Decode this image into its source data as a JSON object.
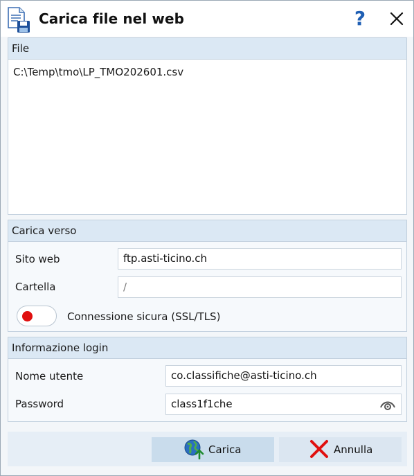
{
  "window": {
    "title": "Carica file nel web",
    "help_label": "?"
  },
  "file_group": {
    "header": "File",
    "items": [
      "C:\\Temp\\tmo\\LP_TMO202601.csv"
    ]
  },
  "upload_group": {
    "header": "Carica verso",
    "site_label": "Sito web",
    "site_value": "ftp.asti-ticino.ch",
    "folder_label": "Cartella",
    "folder_value": "/",
    "secure_label": "Connessione sicura (SSL/TLS)",
    "secure_enabled": false
  },
  "login_group": {
    "header": "Informazione login",
    "user_label": "Nome utente",
    "user_value": "co.classifiche@asti-ticino.ch",
    "password_label": "Password",
    "password_value": "class1f1che"
  },
  "footer": {
    "upload_label": "Carica",
    "cancel_label": "Annulla"
  },
  "colors": {
    "accent": "#1f5fb4",
    "group_header": "#dbe8f4",
    "toggle_off": "#e01010",
    "cancel_icon": "#e01010"
  }
}
